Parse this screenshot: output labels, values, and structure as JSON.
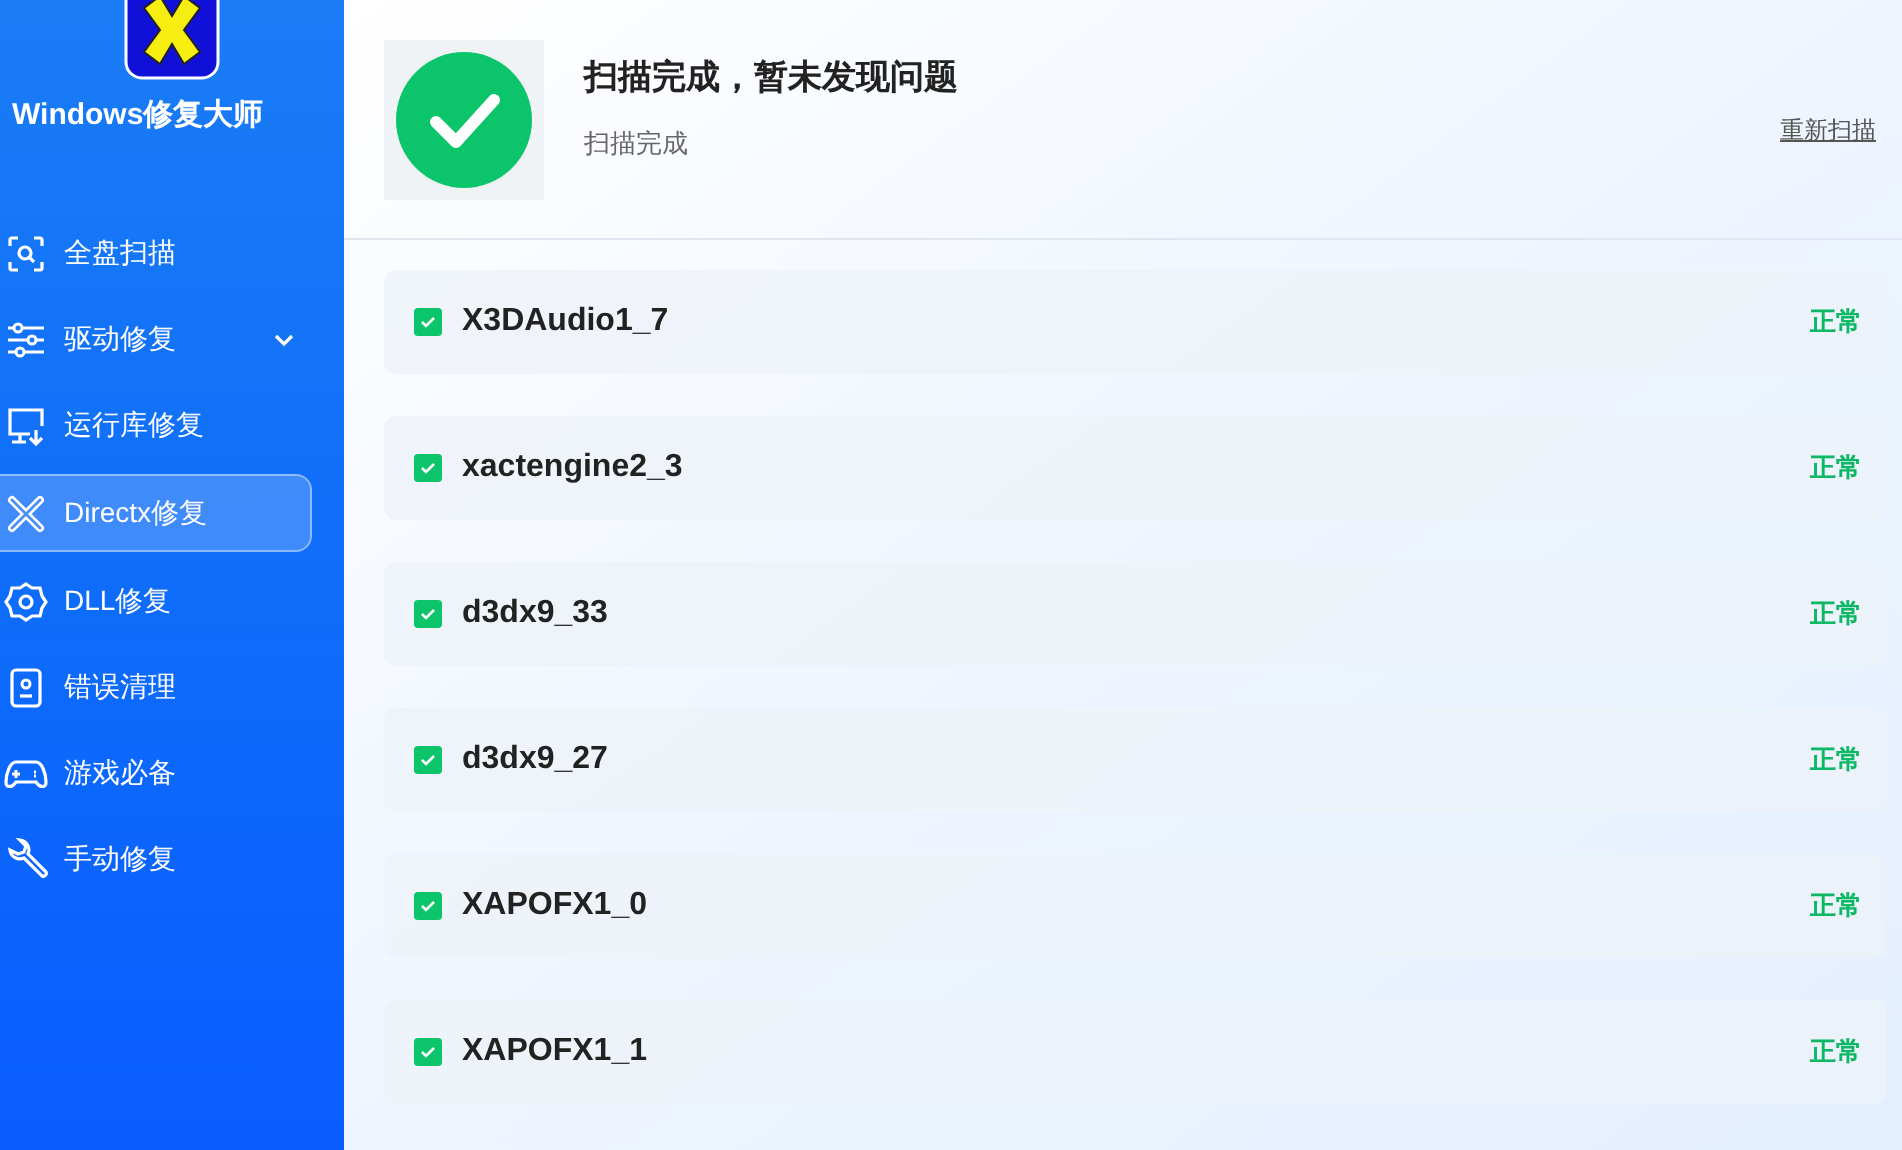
{
  "app": {
    "title": "Windows修复大师"
  },
  "sidebar": {
    "items": [
      {
        "kind": "scan",
        "label": "全盘扫描",
        "selected": false
      },
      {
        "kind": "driver",
        "label": "驱动修复",
        "selected": false,
        "expanded": false
      },
      {
        "kind": "runtime",
        "label": "运行库修复",
        "selected": false
      },
      {
        "kind": "directx",
        "label": "Directx修复",
        "selected": true
      },
      {
        "kind": "dll",
        "label": "DLL修复",
        "selected": false
      },
      {
        "kind": "error",
        "label": "错误清理",
        "selected": false
      },
      {
        "kind": "game",
        "label": "游戏必备",
        "selected": false
      },
      {
        "kind": "manual",
        "label": "手动修复",
        "selected": false
      }
    ]
  },
  "header": {
    "title": "扫描完成，暂未发现问题",
    "subtitle": "扫描完成",
    "rescan": "重新扫描"
  },
  "results": [
    {
      "name": "X3DAudio1_7",
      "checked": true,
      "status": "正常"
    },
    {
      "name": "xactengine2_3",
      "checked": true,
      "status": "正常"
    },
    {
      "name": "d3dx9_33",
      "checked": true,
      "status": "正常"
    },
    {
      "name": "d3dx9_27",
      "checked": true,
      "status": "正常"
    },
    {
      "name": "XAPOFX1_0",
      "checked": true,
      "status": "正常"
    },
    {
      "name": "XAPOFX1_1",
      "checked": true,
      "status": "正常"
    }
  ]
}
